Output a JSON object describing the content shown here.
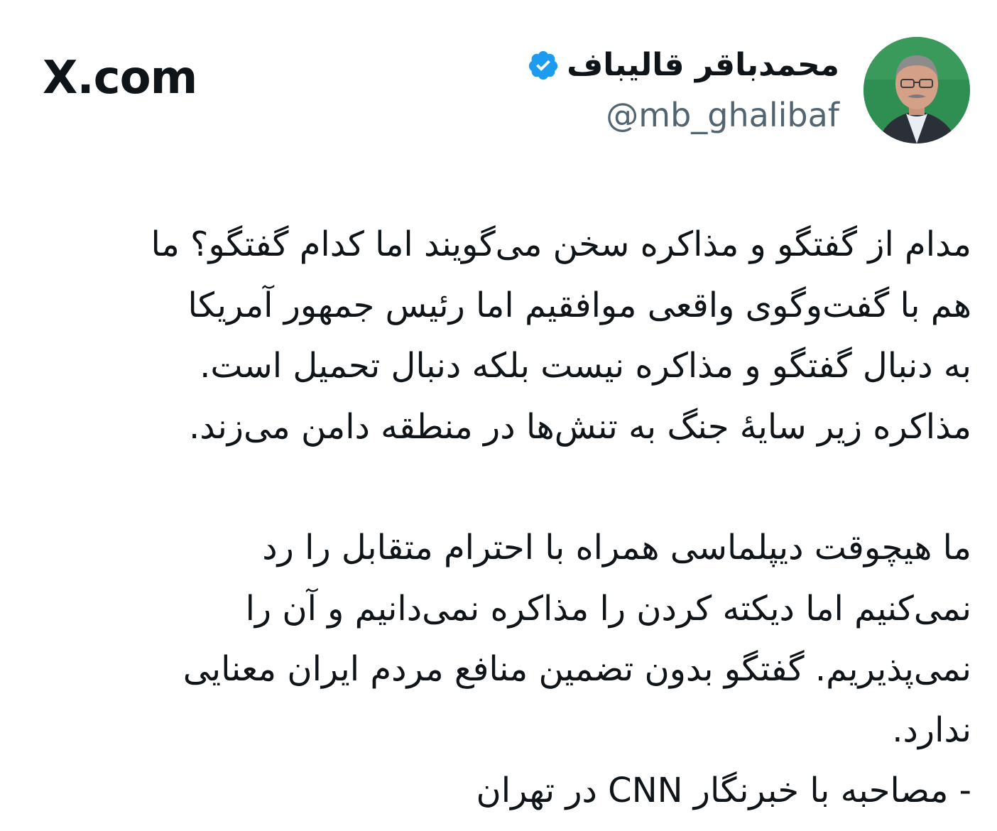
{
  "header": {
    "display_name": "محمدباقر قالیباف",
    "handle": "@mb_ghalibaf",
    "site_logo": "X.com",
    "verified_icon": "verified-badge-icon",
    "verified_color": "#1d9bf0"
  },
  "tweet": {
    "paragraph_1": [
      "مدام از گفتگو و مذاکره سخن می‌گویند اما کدام گفتگو؟ ما",
      "هم با گفت‌وگوی واقعی موافقیم اما رئیس جمهور آمریکا",
      "به دنبال گفتگو و مذاکره نیست بلکه دنبال تحمیل است.",
      "مذاکره زیر سایهٔ جنگ به تنش‌ها در منطقه دامن می‌زند."
    ],
    "paragraph_2": [
      "ما هیچوقت دیپلماسی همراه با احترام متقابل را رد",
      "نمی‌کنیم اما دیکته کردن را مذاکره نمی‌دانیم و آن را",
      "نمی‌پذیریم. گفتگو بدون تضمین منافع مردم ایران معنایی",
      "ندارد.",
      "- مصاحبه با خبرنگار CNN در تهران"
    ]
  },
  "colors": {
    "text": "#0f1419",
    "secondary": "#536471",
    "avatar_background": "#2f8f52"
  }
}
